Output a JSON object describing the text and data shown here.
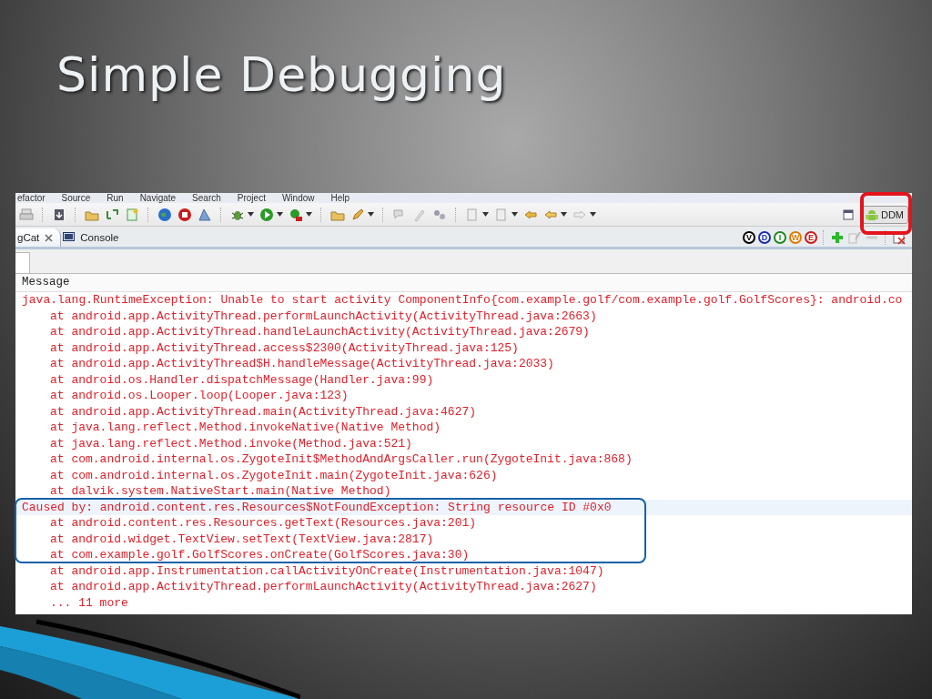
{
  "slide": {
    "title": "Simple Debugging"
  },
  "menu_bar": [
    "efactor",
    "Source",
    "Run",
    "Navigate",
    "Search",
    "Project",
    "Window",
    "Help"
  ],
  "perspective_button": {
    "label": "DDM"
  },
  "tabs": [
    {
      "label": "gCat",
      "selected": true
    },
    {
      "label": "Console",
      "selected": false
    }
  ],
  "log_levels": [
    {
      "label": "V",
      "color": "#000000"
    },
    {
      "label": "D",
      "color": "#1a2fa8"
    },
    {
      "label": "I",
      "color": "#1c8a1c"
    },
    {
      "label": "W",
      "color": "#e07a00"
    },
    {
      "label": "E",
      "color": "#d01818"
    }
  ],
  "log": {
    "column": "Message",
    "rows": [
      {
        "kind": "header",
        "text": "java.lang.RuntimeException: Unable to start activity ComponentInfo{com.example.golf/com.example.golf.GolfScores}: android.co",
        "selected": false
      },
      {
        "kind": "frame",
        "text": "at android.app.ActivityThread.performLaunchActivity(ActivityThread.java:2663)",
        "selected": false
      },
      {
        "kind": "frame",
        "text": "at android.app.ActivityThread.handleLaunchActivity(ActivityThread.java:2679)",
        "selected": false
      },
      {
        "kind": "frame",
        "text": "at android.app.ActivityThread.access$2300(ActivityThread.java:125)",
        "selected": false
      },
      {
        "kind": "frame",
        "text": "at android.app.ActivityThread$H.handleMessage(ActivityThread.java:2033)",
        "selected": false
      },
      {
        "kind": "frame",
        "text": "at android.os.Handler.dispatchMessage(Handler.java:99)",
        "selected": false
      },
      {
        "kind": "frame",
        "text": "at android.os.Looper.loop(Looper.java:123)",
        "selected": false
      },
      {
        "kind": "frame",
        "text": "at android.app.ActivityThread.main(ActivityThread.java:4627)",
        "selected": false
      },
      {
        "kind": "frame",
        "text": "at java.lang.reflect.Method.invokeNative(Native Method)",
        "selected": false
      },
      {
        "kind": "frame",
        "text": "at java.lang.reflect.Method.invoke(Method.java:521)",
        "selected": false
      },
      {
        "kind": "frame",
        "text": "at com.android.internal.os.ZygoteInit$MethodAndArgsCaller.run(ZygoteInit.java:868)",
        "selected": false
      },
      {
        "kind": "frame",
        "text": "at com.android.internal.os.ZygoteInit.main(ZygoteInit.java:626)",
        "selected": false
      },
      {
        "kind": "frame",
        "text": "at dalvik.system.NativeStart.main(Native Method)",
        "selected": false
      },
      {
        "kind": "header",
        "text": "Caused by: android.content.res.Resources$NotFoundException: String resource ID #0x0",
        "selected": true
      },
      {
        "kind": "frame",
        "text": "at android.content.res.Resources.getText(Resources.java:201)",
        "selected": false
      },
      {
        "kind": "frame",
        "text": "at android.widget.TextView.setText(TextView.java:2817)",
        "selected": false
      },
      {
        "kind": "frame",
        "text": "at com.example.golf.GolfScores.onCreate(GolfScores.java:30)",
        "selected": false
      },
      {
        "kind": "frame",
        "text": "at android.app.Instrumentation.callActivityOnCreate(Instrumentation.java:1047)",
        "selected": false
      },
      {
        "kind": "frame",
        "text": "at android.app.ActivityThread.performLaunchActivity(ActivityThread.java:2627)",
        "selected": false
      },
      {
        "kind": "frame",
        "text": "... 11 more",
        "selected": false
      }
    ]
  }
}
